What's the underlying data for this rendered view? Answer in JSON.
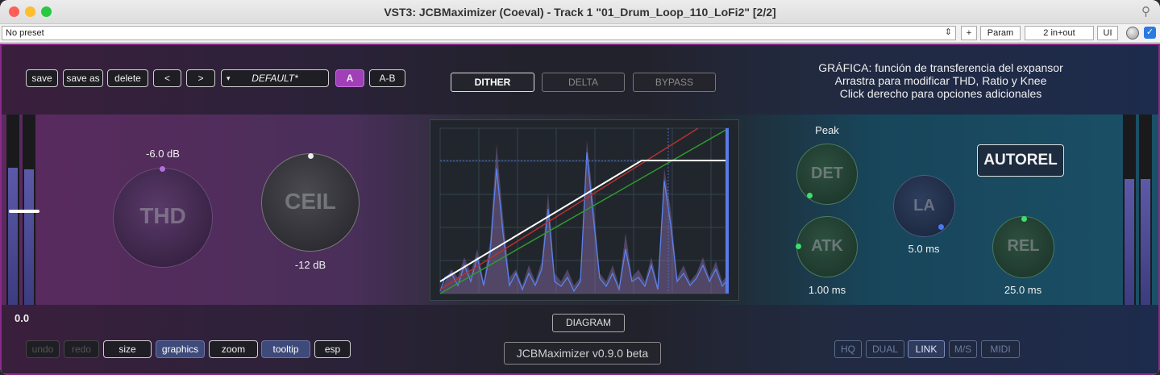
{
  "window": {
    "title": "VST3: JCBMaximizer (Coeval) - Track 1 \"01_Drum_Loop_110_LoFi2\" [2/2]"
  },
  "host": {
    "preset": "No preset",
    "plus": "+",
    "param": "Param",
    "io": "2 in+out",
    "ui": "UI"
  },
  "toolbar": {
    "save": "save",
    "save_as": "save as",
    "delete": "delete",
    "prev": "<",
    "next": ">",
    "preset_name": "DEFAULT*",
    "a": "A",
    "ab": "A-B"
  },
  "modes": {
    "dither": "DITHER",
    "delta": "DELTA",
    "bypass": "BYPASS"
  },
  "hint": {
    "line1": "GRÁFICA: función de transferencia del expansor",
    "line2": "Arrastra para modificar THD, Ratio y Knee",
    "line3": "Click derecho para opciones adicionales"
  },
  "knobs": {
    "thd": {
      "label": "THD",
      "value": "-6.0 dB"
    },
    "ceil": {
      "label": "CEIL",
      "value": "-12 dB"
    },
    "det": {
      "label": "DET",
      "caption": "Peak"
    },
    "atk": {
      "label": "ATK",
      "value": "1.00 ms"
    },
    "la": {
      "label": "LA",
      "value": "5.0 ms"
    },
    "rel": {
      "label": "REL",
      "value": "25.0 ms"
    }
  },
  "autorel": "AUTOREL",
  "meter_value": "0.0",
  "diagram": "DIAGRAM",
  "version": "JCBMaximizer v0.9.0 beta",
  "bottom_left": {
    "undo": "undo",
    "redo": "redo",
    "size": "size",
    "graphics": "graphics",
    "zoom": "zoom",
    "tooltip": "tooltip",
    "esp": "esp"
  },
  "bottom_right": {
    "hq": "HQ",
    "dual": "DUAL",
    "link": "LINK",
    "ms": "M/S",
    "midi": "MIDI"
  },
  "colors": {
    "accent": "#9b3fb5",
    "transfer": "#ffffff",
    "signal": "#5a7ae8",
    "threshold": "#2ea02e",
    "ceiling": "#b02a2a"
  }
}
